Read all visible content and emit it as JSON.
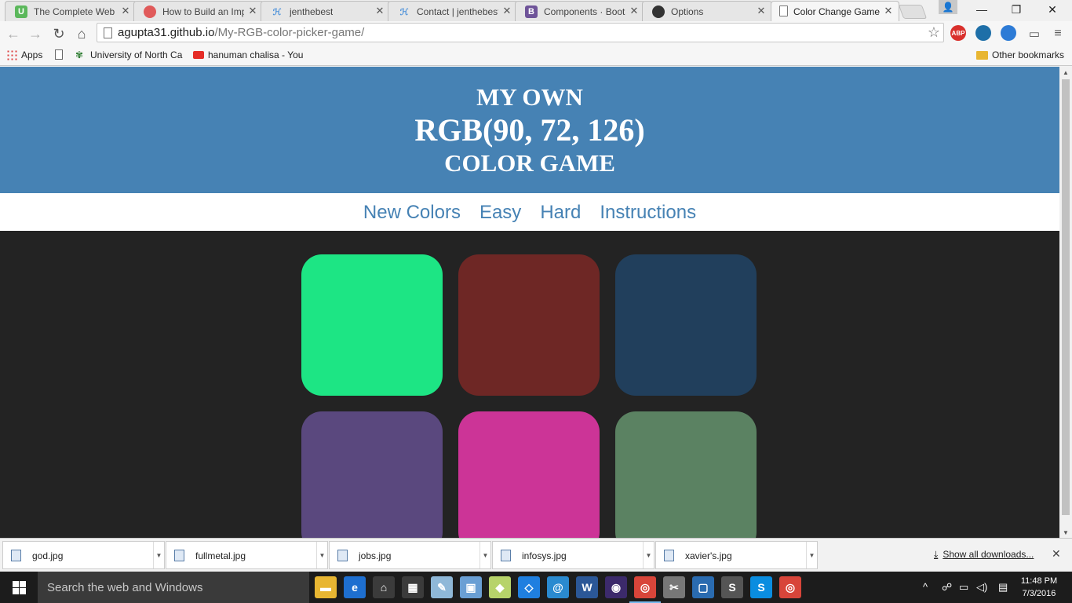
{
  "browser": {
    "tabs": [
      {
        "title": "The Complete Web D",
        "favicon": "udemy-icon",
        "favicon_text": "U",
        "favicon_color": "#5cb85c"
      },
      {
        "title": "How to Build an Imp",
        "favicon": "tutorial-site-icon",
        "favicon_text": "",
        "favicon_color": "#e05a5a"
      },
      {
        "title": "jenthebest",
        "favicon": "jsfiddle-icon",
        "favicon_text": "",
        "favicon_color": "#4a90d9"
      },
      {
        "title": "Contact | jenthebest",
        "favicon": "jsfiddle-icon",
        "favicon_text": "",
        "favicon_color": "#4a90d9"
      },
      {
        "title": "Components · Boots",
        "favicon": "bootstrap-icon",
        "favicon_text": "B",
        "favicon_color": "#6f5499"
      },
      {
        "title": "Options",
        "favicon": "github-icon",
        "favicon_text": "",
        "favicon_color": "#333333"
      },
      {
        "title": "Color Change Game",
        "favicon": "page-icon",
        "favicon_text": "",
        "favicon_color": "#ffffff",
        "active": true
      }
    ],
    "url_host": "agupta31.github.io",
    "url_path": "/My-RGB-color-picker-game/",
    "bookmarks": [
      {
        "label": "Apps",
        "icon": "apps-grid-icon"
      },
      {
        "label": "",
        "icon": "blank-page-icon"
      },
      {
        "label": "University of North Ca",
        "icon": "university-icon"
      },
      {
        "label": "hanuman chalisa - You",
        "icon": "youtube-icon"
      }
    ],
    "other_bookmarks": "Other bookmarks",
    "extensions": [
      {
        "label": "ABP",
        "color": "#d9302c"
      },
      {
        "label": "",
        "color": "#1e6fa8"
      },
      {
        "label": "",
        "color": "#2d7bd6"
      }
    ]
  },
  "game": {
    "title_top": "MY OWN",
    "target_color": "RGB(90, 72, 126)",
    "title_bottom": "COLOR GAME",
    "header_bg": "#4682b4",
    "body_bg": "#232323",
    "menu": [
      "New Colors",
      "Easy",
      "Hard",
      "Instructions"
    ],
    "squares": [
      "rgb(29, 229, 132)",
      "rgb(110, 39, 37)",
      "rgb(33, 63, 92)",
      "rgb(90, 72, 126)",
      "rgb(204, 52, 151)",
      "rgb(91, 130, 98)"
    ]
  },
  "downloads": {
    "files": [
      "god.jpg",
      "fullmetal.jpg",
      "jobs.jpg",
      "infosys.jpg",
      "xavier's.jpg"
    ],
    "show_all": "Show all downloads..."
  },
  "taskbar": {
    "search_placeholder": "Search the web and Windows",
    "apps": [
      {
        "name": "file-explorer",
        "color": "#e8b632",
        "glyph": "▬"
      },
      {
        "name": "edge",
        "color": "#1e6fd0",
        "glyph": "e"
      },
      {
        "name": "store",
        "color": "#3b3b3b",
        "glyph": "⌂"
      },
      {
        "name": "calculator",
        "color": "#3b3b3b",
        "glyph": "▦"
      },
      {
        "name": "notepad-plus",
        "color": "#8fb8d8",
        "glyph": "✎"
      },
      {
        "name": "sticky",
        "color": "#6a9fd4",
        "glyph": "▣"
      },
      {
        "name": "folder-green",
        "color": "#b7d36a",
        "glyph": "◆"
      },
      {
        "name": "dropbox",
        "color": "#1f7fe0",
        "glyph": "◇"
      },
      {
        "name": "onedrive-note",
        "color": "#2a8ad0",
        "glyph": "@"
      },
      {
        "name": "word",
        "color": "#2b5797",
        "glyph": "W"
      },
      {
        "name": "eclipse",
        "color": "#3c2a6b",
        "glyph": "◉"
      },
      {
        "name": "chrome",
        "color": "#d8453a",
        "glyph": "◎",
        "running": true
      },
      {
        "name": "snipping",
        "color": "#777777",
        "glyph": "✂"
      },
      {
        "name": "brackets",
        "color": "#2a6bb0",
        "glyph": "▢"
      },
      {
        "name": "sublime",
        "color": "#555555",
        "glyph": "S"
      },
      {
        "name": "skype",
        "color": "#0a8de0",
        "glyph": "S"
      },
      {
        "name": "chrome-2",
        "color": "#d8453a",
        "glyph": "◎"
      }
    ],
    "time": "11:48 PM",
    "date": "7/3/2016"
  }
}
